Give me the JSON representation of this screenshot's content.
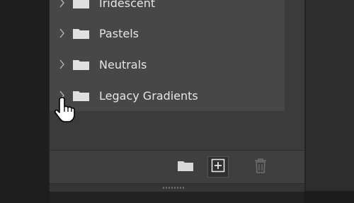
{
  "gradients_panel": {
    "groups": [
      {
        "label": "Iridescent"
      },
      {
        "label": "Pastels"
      },
      {
        "label": "Neutrals"
      },
      {
        "label": "Legacy Gradients"
      }
    ]
  },
  "footer": {
    "folder_button_icon": "folder-icon",
    "new_button_icon": "plus-square-icon",
    "delete_button_icon": "trash-icon"
  },
  "colors": {
    "background": "#222222",
    "panel": "#3b3b3b",
    "list": "#474747",
    "text": "#e6e6e6"
  }
}
